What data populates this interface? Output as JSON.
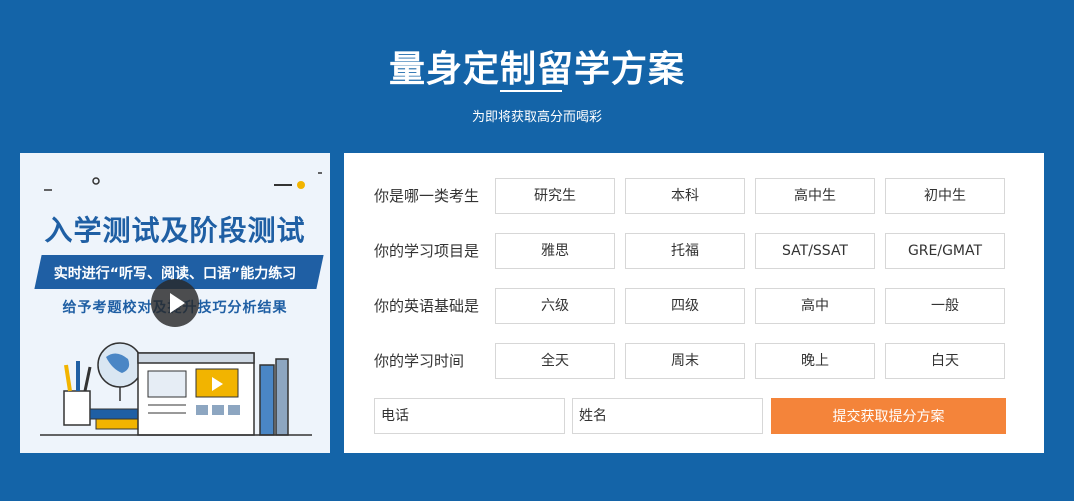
{
  "header": {
    "title": "量身定制留学方案",
    "subtitle": "为即将获取高分而喝彩"
  },
  "promo": {
    "title": "入学测试及阶段测试",
    "ribbon": "实时进行“听写、阅读、口语”能力练习",
    "subtitle": "给予考题校对及提升技巧分析结果",
    "play_icon": "play-icon"
  },
  "form": {
    "rows": [
      {
        "label": "你是哪一类考生",
        "options": [
          "研究生",
          "本科",
          "高中生",
          "初中生"
        ]
      },
      {
        "label": "你的学习项目是",
        "options": [
          "雅思",
          "托福",
          "SAT/SSAT",
          "GRE/GMAT"
        ]
      },
      {
        "label": "你的英语基础是",
        "options": [
          "六级",
          "四级",
          "高中",
          "一般"
        ]
      },
      {
        "label": "你的学习时间",
        "options": [
          "全天",
          "周末",
          "晚上",
          "白天"
        ]
      }
    ],
    "phone_placeholder": "电话",
    "name_placeholder": "姓名",
    "submit_label": "提交获取提分方案"
  },
  "colors": {
    "background": "#1464a8",
    "brand_blue": "#1f5fa4",
    "submit": "#f4843a"
  }
}
